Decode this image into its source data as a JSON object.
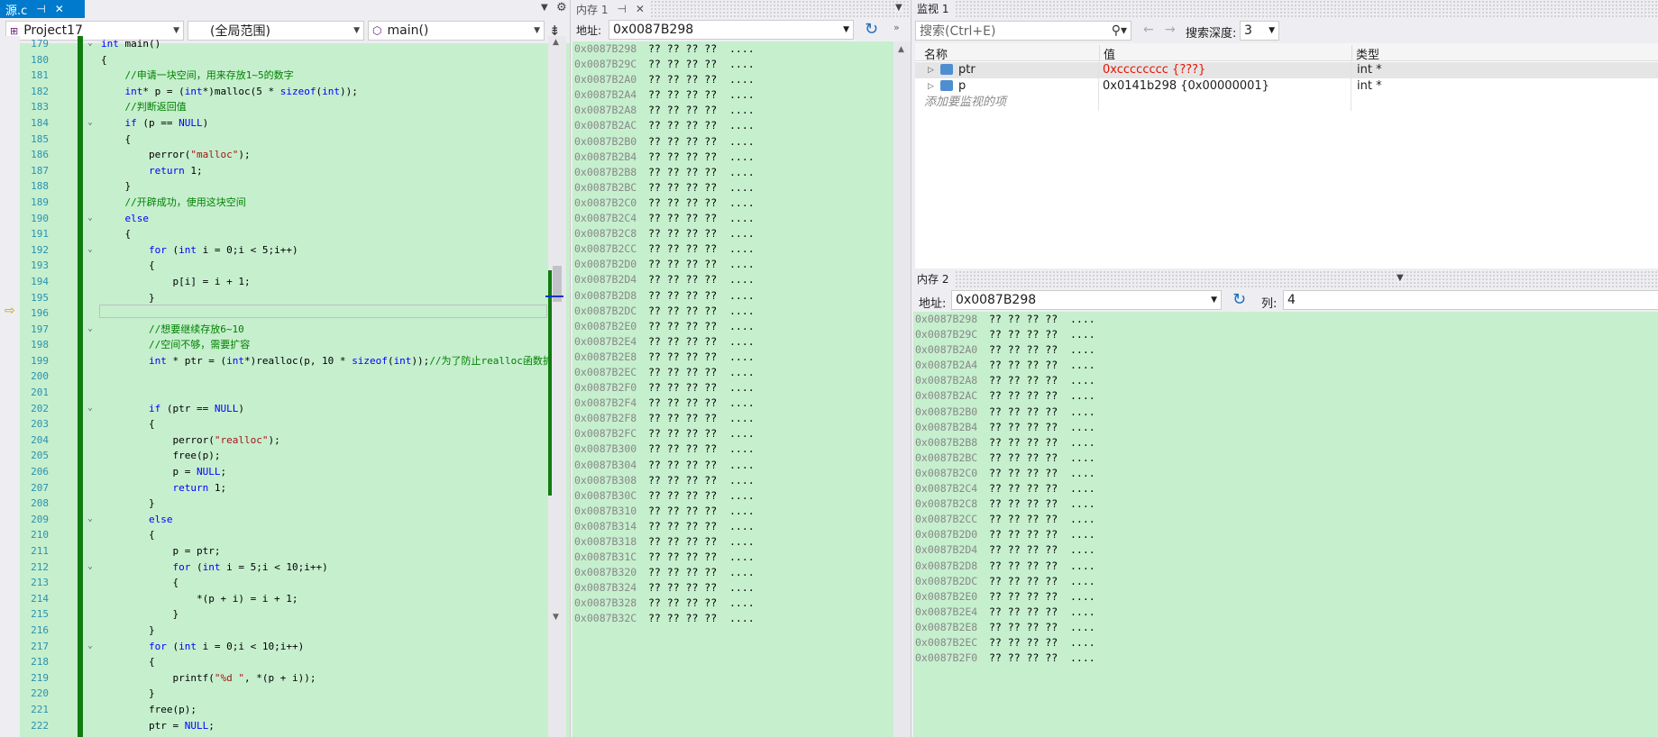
{
  "editor": {
    "tab_title": "源.c",
    "tab_pin": "⊣",
    "tab_close": "✕",
    "project": "Project17",
    "scope": "(全局范围)",
    "function": "main()",
    "lines": [
      {
        "n": "179",
        "fold": "⌄",
        "html": "<span class='kw'>int</span> main()"
      },
      {
        "n": "180",
        "fold": "",
        "html": "{"
      },
      {
        "n": "181",
        "fold": "",
        "html": "    <span class='cm'>//申请一块空间，用来存放1~5的数字</span>"
      },
      {
        "n": "182",
        "fold": "",
        "html": "    <span class='kw'>int</span>* p = (<span class='kw'>int</span>*)malloc(5 * <span class='kw'>sizeof</span>(<span class='kw'>int</span>));"
      },
      {
        "n": "183",
        "fold": "",
        "html": "    <span class='cm'>//判断返回值</span>"
      },
      {
        "n": "184",
        "fold": "⌄",
        "html": "    <span class='kw'>if</span> (p == <span class='kw'>NULL</span>)"
      },
      {
        "n": "185",
        "fold": "",
        "html": "    {"
      },
      {
        "n": "186",
        "fold": "",
        "html": "        perror(<span class='st'>\"malloc\"</span>);"
      },
      {
        "n": "187",
        "fold": "",
        "html": "        <span class='kw'>return</span> 1;"
      },
      {
        "n": "188",
        "fold": "",
        "html": "    }"
      },
      {
        "n": "189",
        "fold": "",
        "html": "    <span class='cm'>//开辟成功，使用这块空间</span>"
      },
      {
        "n": "190",
        "fold": "⌄",
        "html": "    <span class='kw'>else</span>"
      },
      {
        "n": "191",
        "fold": "",
        "html": "    {"
      },
      {
        "n": "192",
        "fold": "⌄",
        "html": "        <span class='kw'>for</span> (<span class='kw'>int</span> i = 0;i &lt; 5;i++)"
      },
      {
        "n": "193",
        "fold": "",
        "html": "        {"
      },
      {
        "n": "194",
        "fold": "",
        "html": "            p[i] = i + 1;"
      },
      {
        "n": "195",
        "fold": "",
        "html": "        }"
      },
      {
        "n": "196",
        "fold": "",
        "html": ""
      },
      {
        "n": "197",
        "fold": "⌄",
        "html": "        <span class='cm'>//想要继续存放6~10</span>"
      },
      {
        "n": "198",
        "fold": "",
        "html": "        <span class='cm'>//空间不够，需要扩容</span>"
      },
      {
        "n": "199",
        "fold": "",
        "html": "        <span class='kw'>int</span> * ptr = (<span class='kw'>int</span>*)realloc(p, 10 * <span class='kw'>sizeof</span>(<span class='kw'>int</span>));<span class='cm'>//为了防止realloc函数扩容失</span>"
      },
      {
        "n": "200",
        "fold": "",
        "html": ""
      },
      {
        "n": "201",
        "fold": "",
        "html": ""
      },
      {
        "n": "202",
        "fold": "⌄",
        "html": "        <span class='kw'>if</span> (ptr == <span class='kw'>NULL</span>)"
      },
      {
        "n": "203",
        "fold": "",
        "html": "        {"
      },
      {
        "n": "204",
        "fold": "",
        "html": "            perror(<span class='st'>\"realloc\"</span>);"
      },
      {
        "n": "205",
        "fold": "",
        "html": "            free(p);"
      },
      {
        "n": "206",
        "fold": "",
        "html": "            p = <span class='kw'>NULL</span>;"
      },
      {
        "n": "207",
        "fold": "",
        "html": "            <span class='kw'>return</span> 1;"
      },
      {
        "n": "208",
        "fold": "",
        "html": "        }"
      },
      {
        "n": "209",
        "fold": "⌄",
        "html": "        <span class='kw'>else</span>"
      },
      {
        "n": "210",
        "fold": "",
        "html": "        {"
      },
      {
        "n": "211",
        "fold": "",
        "html": "            p = ptr;"
      },
      {
        "n": "212",
        "fold": "⌄",
        "html": "            <span class='kw'>for</span> (<span class='kw'>int</span> i = 5;i &lt; 10;i++)"
      },
      {
        "n": "213",
        "fold": "",
        "html": "            {"
      },
      {
        "n": "214",
        "fold": "",
        "html": "                *(p + i) = i + 1;"
      },
      {
        "n": "215",
        "fold": "",
        "html": "            }"
      },
      {
        "n": "216",
        "fold": "",
        "html": "        }"
      },
      {
        "n": "217",
        "fold": "⌄",
        "html": "        <span class='kw'>for</span> (<span class='kw'>int</span> i = 0;i &lt; 10;i++)"
      },
      {
        "n": "218",
        "fold": "",
        "html": "        {"
      },
      {
        "n": "219",
        "fold": "",
        "html": "            printf(<span class='st'>\"%d \"</span>, *(p + i));"
      },
      {
        "n": "220",
        "fold": "",
        "html": "        }"
      },
      {
        "n": "221",
        "fold": "",
        "html": "        free(p);"
      },
      {
        "n": "222",
        "fold": "",
        "html": "        ptr = <span class='kw'>NULL</span>;"
      }
    ]
  },
  "memory1": {
    "title": "内存 1",
    "address_label": "地址:",
    "address_value": "0x0087B298",
    "rows": [
      {
        "addr": "0x0087B298",
        "bytes": "?? ?? ?? ??",
        "ascii": "...."
      },
      {
        "addr": "0x0087B29C",
        "bytes": "?? ?? ?? ??",
        "ascii": "...."
      },
      {
        "addr": "0x0087B2A0",
        "bytes": "?? ?? ?? ??",
        "ascii": "...."
      },
      {
        "addr": "0x0087B2A4",
        "bytes": "?? ?? ?? ??",
        "ascii": "...."
      },
      {
        "addr": "0x0087B2A8",
        "bytes": "?? ?? ?? ??",
        "ascii": "...."
      },
      {
        "addr": "0x0087B2AC",
        "bytes": "?? ?? ?? ??",
        "ascii": "...."
      },
      {
        "addr": "0x0087B2B0",
        "bytes": "?? ?? ?? ??",
        "ascii": "...."
      },
      {
        "addr": "0x0087B2B4",
        "bytes": "?? ?? ?? ??",
        "ascii": "...."
      },
      {
        "addr": "0x0087B2B8",
        "bytes": "?? ?? ?? ??",
        "ascii": "...."
      },
      {
        "addr": "0x0087B2BC",
        "bytes": "?? ?? ?? ??",
        "ascii": "...."
      },
      {
        "addr": "0x0087B2C0",
        "bytes": "?? ?? ?? ??",
        "ascii": "...."
      },
      {
        "addr": "0x0087B2C4",
        "bytes": "?? ?? ?? ??",
        "ascii": "...."
      },
      {
        "addr": "0x0087B2C8",
        "bytes": "?? ?? ?? ??",
        "ascii": "...."
      },
      {
        "addr": "0x0087B2CC",
        "bytes": "?? ?? ?? ??",
        "ascii": "...."
      },
      {
        "addr": "0x0087B2D0",
        "bytes": "?? ?? ?? ??",
        "ascii": "...."
      },
      {
        "addr": "0x0087B2D4",
        "bytes": "?? ?? ?? ??",
        "ascii": "...."
      },
      {
        "addr": "0x0087B2D8",
        "bytes": "?? ?? ?? ??",
        "ascii": "...."
      },
      {
        "addr": "0x0087B2DC",
        "bytes": "?? ?? ?? ??",
        "ascii": "...."
      },
      {
        "addr": "0x0087B2E0",
        "bytes": "?? ?? ?? ??",
        "ascii": "...."
      },
      {
        "addr": "0x0087B2E4",
        "bytes": "?? ?? ?? ??",
        "ascii": "...."
      },
      {
        "addr": "0x0087B2E8",
        "bytes": "?? ?? ?? ??",
        "ascii": "...."
      },
      {
        "addr": "0x0087B2EC",
        "bytes": "?? ?? ?? ??",
        "ascii": "...."
      },
      {
        "addr": "0x0087B2F0",
        "bytes": "?? ?? ?? ??",
        "ascii": "...."
      },
      {
        "addr": "0x0087B2F4",
        "bytes": "?? ?? ?? ??",
        "ascii": "...."
      },
      {
        "addr": "0x0087B2F8",
        "bytes": "?? ?? ?? ??",
        "ascii": "...."
      },
      {
        "addr": "0x0087B2FC",
        "bytes": "?? ?? ?? ??",
        "ascii": "...."
      },
      {
        "addr": "0x0087B300",
        "bytes": "?? ?? ?? ??",
        "ascii": "...."
      },
      {
        "addr": "0x0087B304",
        "bytes": "?? ?? ?? ??",
        "ascii": "...."
      },
      {
        "addr": "0x0087B308",
        "bytes": "?? ?? ?? ??",
        "ascii": "...."
      },
      {
        "addr": "0x0087B30C",
        "bytes": "?? ?? ?? ??",
        "ascii": "...."
      },
      {
        "addr": "0x0087B310",
        "bytes": "?? ?? ?? ??",
        "ascii": "...."
      },
      {
        "addr": "0x0087B314",
        "bytes": "?? ?? ?? ??",
        "ascii": "...."
      },
      {
        "addr": "0x0087B318",
        "bytes": "?? ?? ?? ??",
        "ascii": "...."
      },
      {
        "addr": "0x0087B31C",
        "bytes": "?? ?? ?? ??",
        "ascii": "...."
      },
      {
        "addr": "0x0087B320",
        "bytes": "?? ?? ?? ??",
        "ascii": "...."
      },
      {
        "addr": "0x0087B324",
        "bytes": "?? ?? ?? ??",
        "ascii": "...."
      },
      {
        "addr": "0x0087B328",
        "bytes": "?? ?? ?? ??",
        "ascii": "...."
      },
      {
        "addr": "0x0087B32C",
        "bytes": "?? ?? ?? ??",
        "ascii": "...."
      }
    ]
  },
  "watch1": {
    "title": "监视 1",
    "search_placeholder": "搜索(Ctrl+E)",
    "search_depth_label": "搜索深度:",
    "search_depth_value": "3",
    "columns": {
      "name": "名称",
      "value": "值",
      "type": "类型"
    },
    "rows": [
      {
        "name": "ptr",
        "value": "0xcccccccc {???}",
        "type": "int *",
        "error": true
      },
      {
        "name": "p",
        "value": "0x0141b298 {0x00000001}",
        "type": "int *",
        "error": false
      }
    ],
    "add_item": "添加要监视的项"
  },
  "memory2": {
    "title": "内存 2",
    "address_label": "地址:",
    "address_value": "0x0087B298",
    "columns_label": "列:",
    "columns_value": "4",
    "rows": [
      {
        "addr": "0x0087B298",
        "bytes": "?? ?? ?? ??",
        "ascii": "...."
      },
      {
        "addr": "0x0087B29C",
        "bytes": "?? ?? ?? ??",
        "ascii": "...."
      },
      {
        "addr": "0x0087B2A0",
        "bytes": "?? ?? ?? ??",
        "ascii": "...."
      },
      {
        "addr": "0x0087B2A4",
        "bytes": "?? ?? ?? ??",
        "ascii": "...."
      },
      {
        "addr": "0x0087B2A8",
        "bytes": "?? ?? ?? ??",
        "ascii": "...."
      },
      {
        "addr": "0x0087B2AC",
        "bytes": "?? ?? ?? ??",
        "ascii": "...."
      },
      {
        "addr": "0x0087B2B0",
        "bytes": "?? ?? ?? ??",
        "ascii": "...."
      },
      {
        "addr": "0x0087B2B4",
        "bytes": "?? ?? ?? ??",
        "ascii": "...."
      },
      {
        "addr": "0x0087B2B8",
        "bytes": "?? ?? ?? ??",
        "ascii": "...."
      },
      {
        "addr": "0x0087B2BC",
        "bytes": "?? ?? ?? ??",
        "ascii": "...."
      },
      {
        "addr": "0x0087B2C0",
        "bytes": "?? ?? ?? ??",
        "ascii": "...."
      },
      {
        "addr": "0x0087B2C4",
        "bytes": "?? ?? ?? ??",
        "ascii": "...."
      },
      {
        "addr": "0x0087B2C8",
        "bytes": "?? ?? ?? ??",
        "ascii": "...."
      },
      {
        "addr": "0x0087B2CC",
        "bytes": "?? ?? ?? ??",
        "ascii": "...."
      },
      {
        "addr": "0x0087B2D0",
        "bytes": "?? ?? ?? ??",
        "ascii": "...."
      },
      {
        "addr": "0x0087B2D4",
        "bytes": "?? ?? ?? ??",
        "ascii": "...."
      },
      {
        "addr": "0x0087B2D8",
        "bytes": "?? ?? ?? ??",
        "ascii": "...."
      },
      {
        "addr": "0x0087B2DC",
        "bytes": "?? ?? ?? ??",
        "ascii": "...."
      },
      {
        "addr": "0x0087B2E0",
        "bytes": "?? ?? ?? ??",
        "ascii": "...."
      },
      {
        "addr": "0x0087B2E4",
        "bytes": "?? ?? ?? ??",
        "ascii": "...."
      },
      {
        "addr": "0x0087B2E8",
        "bytes": "?? ?? ?? ??",
        "ascii": "...."
      },
      {
        "addr": "0x0087B2EC",
        "bytes": "?? ?? ?? ??",
        "ascii": "...."
      },
      {
        "addr": "0x0087B2F0",
        "bytes": "?? ?? ?? ??",
        "ascii": "...."
      }
    ]
  },
  "colors": {
    "accent": "#007acc",
    "highlight_green": "#c6efce",
    "change_bar": "#107c10",
    "error_red": "#e51400"
  }
}
